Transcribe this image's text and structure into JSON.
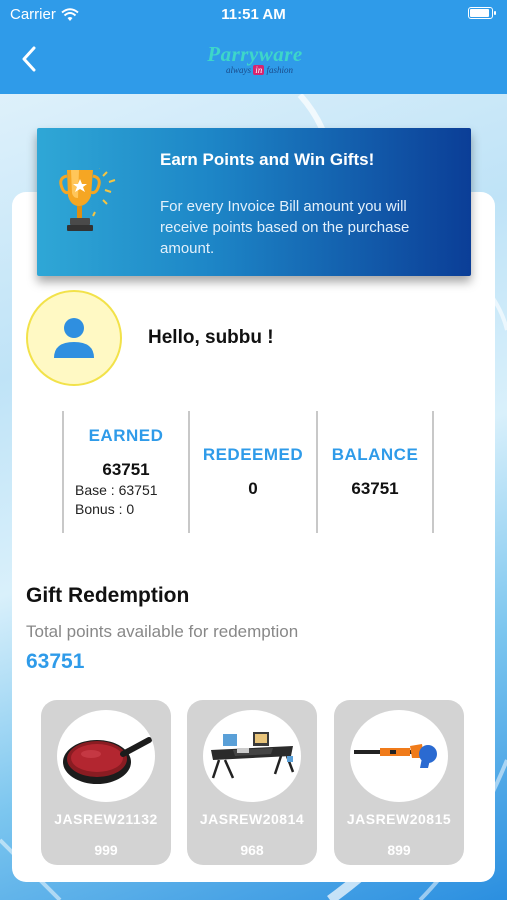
{
  "status_bar": {
    "carrier": "Carrier",
    "time": "11:51 AM",
    "battery_level": 1.0
  },
  "nav": {
    "brand": "Parryware",
    "tagline_pre": "always",
    "tagline_in": "in",
    "tagline_post": "fashion"
  },
  "banner": {
    "title": "Earn Points and Win Gifts!",
    "text": "For every Invoice Bill amount you will receive points based on the purchase amount."
  },
  "profile": {
    "greeting": "Hello, subbu !"
  },
  "stats": {
    "earned_label": "EARNED",
    "earned_value": "63751",
    "base": "Base : 63751",
    "bonus": "Bonus : 0",
    "redeemed_label": "REDEEMED",
    "redeemed_value": "0",
    "balance_label": "BALANCE",
    "balance_value": "63751"
  },
  "redemption": {
    "title": "Gift Redemption",
    "subtitle": "Total points available for redemption",
    "points": "63751"
  },
  "gifts": [
    {
      "code": "JASREW21132",
      "points": "999",
      "icon": "frying-pan-icon"
    },
    {
      "code": "JASREW20814",
      "points": "968",
      "icon": "laptop-table-icon"
    },
    {
      "code": "JASREW20815",
      "points": "899",
      "icon": "air-blower-icon"
    }
  ],
  "colors": {
    "accent": "#2f9be9",
    "avatar_bg": "#fff9c4",
    "gift_card": "#d3d3d3"
  }
}
